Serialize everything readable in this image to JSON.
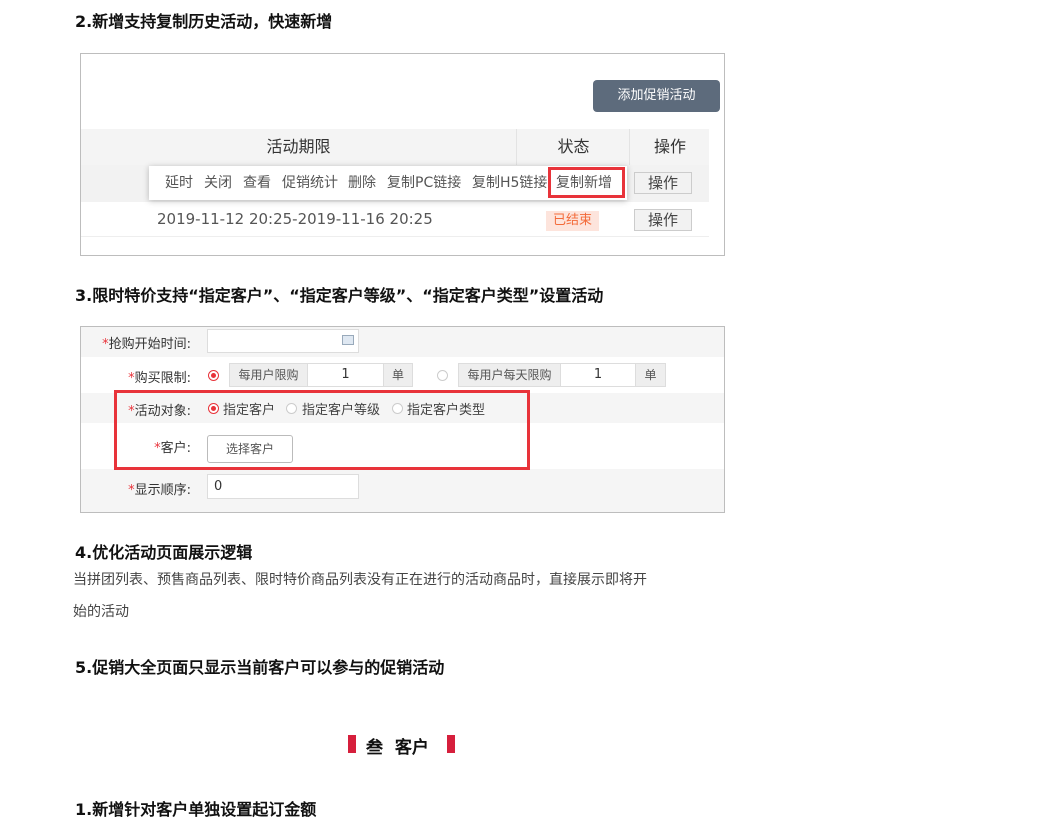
{
  "sections": {
    "s2_title": "2.新增支持复制历史活动，快速新增",
    "s3_title": "3.限时特价支持“指定客户”、“指定客户等级”、“指定客户类型”设置活动",
    "s4_title": "4.优化活动页面展示逻辑",
    "s4_body_line1": "当拼团列表、预售商品列表、限时特价商品列表没有正在进行的活动商品时，直接展示即将开",
    "s4_body_line2": "始的活动",
    "s5_title": "5.促销大全页面只显示当前客户可以参与的促销活动",
    "chapter_title": "叁  客户",
    "s1_title": "1.新增针对客户单独设置起订金额"
  },
  "shot1": {
    "add_button": "添加促销活动",
    "columns": {
      "period": "活动期限",
      "status": "状态",
      "action": "操作"
    },
    "menu_items": [
      "延时",
      "关闭",
      "查看",
      "促销统计",
      "删除",
      "复制PC链接",
      "复制H5链接",
      "复制新增"
    ],
    "row1_action": "操作",
    "row2_period": "2019-11-12 20:25-2019-11-16 20:25",
    "row2_status": "已结束",
    "row2_action": "操作"
  },
  "shot2": {
    "label_start_time": "抢购开始时间:",
    "label_limit": "购买限制:",
    "limit_per_user": "每用户限购",
    "limit_per_user_value": "1",
    "limit_unit": "单",
    "limit_per_user_day": "每用户每天限购",
    "limit_per_user_day_value": "1",
    "limit_unit2": "单",
    "label_target": "活动对象:",
    "target_options": [
      "指定客户",
      "指定客户等级",
      "指定客户类型"
    ],
    "label_customer": "客户:",
    "select_customer": "选择客户",
    "label_order": "显示顺序:",
    "order_value": "0",
    "star": "*"
  },
  "colors": {
    "accent_red": "#e8333a",
    "chapter_bar": "#d61f3c",
    "button_gray": "#5d6b7c"
  }
}
